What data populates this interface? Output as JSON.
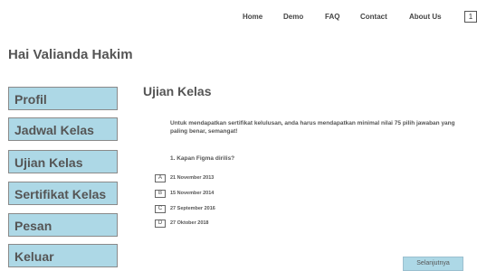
{
  "nav": {
    "items": [
      "Home",
      "Demo",
      "FAQ",
      "Contact",
      "About Us"
    ],
    "badge": "1"
  },
  "greeting": "Hai Valianda Hakim",
  "sidebar": {
    "items": [
      "Profil",
      "Jadwal Kelas",
      "Ujian Kelas",
      "Sertifikat Kelas",
      "Pesan",
      "Keluar"
    ]
  },
  "main": {
    "title": "Ujian Kelas",
    "instruction": "Untuk mendapatkan sertifikat kelulusan, anda harus mendapatkan minimal nilai 75 pilih jawaban yang paling benar, semangat!",
    "question": "1. Kapan Figma dirilis?",
    "options": [
      {
        "letter": "A",
        "text": "21 November 2013"
      },
      {
        "letter": "B",
        "text": "15 November 2014"
      },
      {
        "letter": "C",
        "text": "27 September 2016"
      },
      {
        "letter": "D",
        "text": "27 Oktober 2018"
      }
    ],
    "next_label": "Selanjutnya"
  }
}
